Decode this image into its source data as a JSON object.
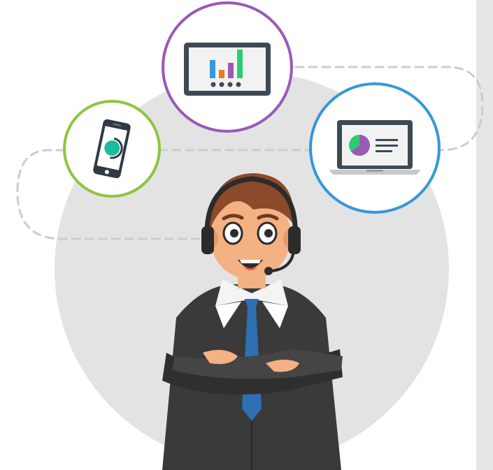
{
  "illustration": {
    "subject": "support-agent-with-headset",
    "devices": [
      {
        "name": "smartphone",
        "icon": "smartphone-icon",
        "ring_color": "#8cc63f"
      },
      {
        "name": "tablet",
        "icon": "bar-chart-tablet-icon",
        "ring_color": "#9b59b6"
      },
      {
        "name": "laptop",
        "icon": "pie-chart-laptop-icon",
        "ring_color": "#3498db"
      }
    ],
    "tablet_chart_bar_colors": [
      "#3498db",
      "#e67e22",
      "#9b59b6",
      "#2ecc71"
    ],
    "laptop_pie_colors": [
      "#9b59b6",
      "#2ecc71"
    ],
    "colors": {
      "backdrop_circle": "#e3e3e3",
      "side_panel": "#e6e6e6",
      "dashed_connector": "#cccccc",
      "suit": "#3a3a3a",
      "tie": "#2f6fb3",
      "skin": "#f4b183",
      "hair": "#8b4a2b",
      "headset": "#2b2b2b"
    }
  }
}
